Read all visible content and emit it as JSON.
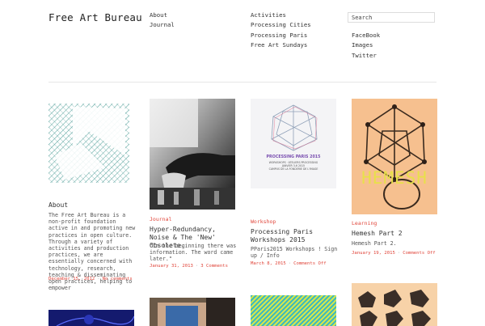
{
  "site": {
    "title": "Free Art Bureau"
  },
  "nav": {
    "col1": [
      "About",
      "Journal"
    ],
    "col2": [
      "Activities",
      "Processing Cities",
      "Processing Paris",
      "Free Art Sundays"
    ]
  },
  "search": {
    "placeholder": "Search"
  },
  "social": [
    "FaceBook",
    "Images",
    "Twitter"
  ],
  "posts": [
    {
      "title": "About",
      "excerpt": "The Free Art Bureau is a non-profit foundation active in and promoting new practices in open culture. Through a variety of activities and production practices, we are essentially concerned with technology, research, teaching & disseminating open practices, helping to empower",
      "date": "December 15, 2012",
      "comments": "No comments"
    },
    {
      "category": "Journal",
      "title": "Hyper-Redundancy, Noise & The 'New' Obsolete.",
      "excerpt": "\"In the beginning there was information. The word came later.\"",
      "date": "January 31, 2013",
      "comments": "3 Comments"
    },
    {
      "category": "Workshop",
      "title": "Processing Paris Workshops 2015",
      "excerpt": "PParis2015 Workshops ! Sign up / Info",
      "date": "March 8, 2015",
      "comments": "Comments Off",
      "poster_lines": [
        "PROCESSING PARIS 2015",
        "WORKSHOPS · ATELIERS PROCESSING",
        "JANVIER 3-6 2015",
        "CAMPUS DE LA FONDERIE DE L'IMAGE"
      ]
    },
    {
      "category": "Learning",
      "title": "Hemesh Part 2",
      "excerpt": "Hemesh Part 2.",
      "date": "January 19, 2015",
      "comments": "Comments Off",
      "image_text": "HEMESH"
    }
  ],
  "colors": {
    "accent": "#e0453a",
    "hemesh_bg": "#f6c08f",
    "hemesh_text": "#e8e04a"
  }
}
